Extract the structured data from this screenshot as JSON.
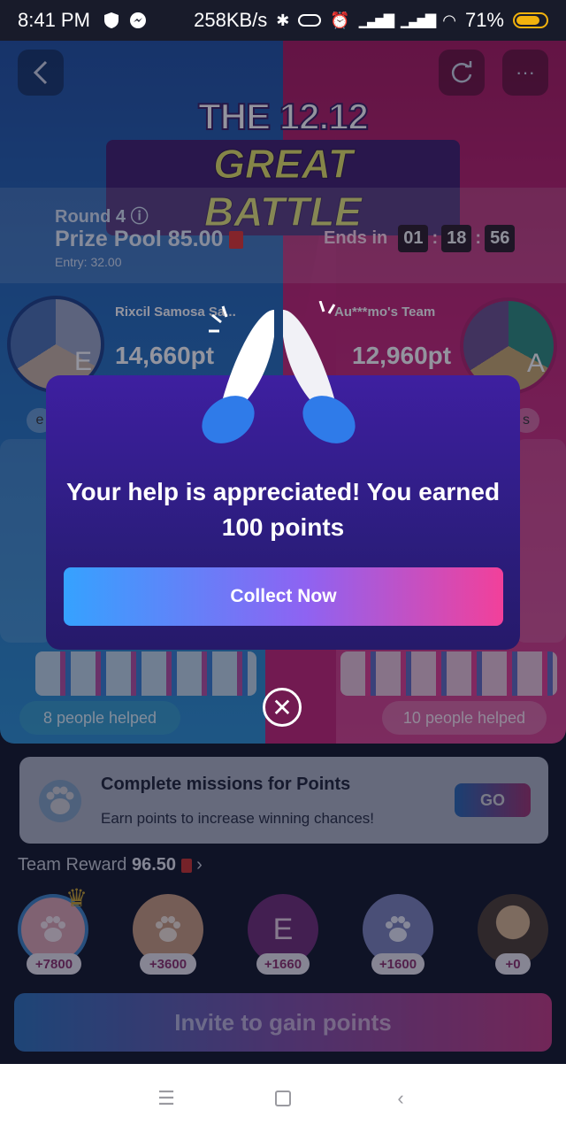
{
  "status_bar": {
    "time": "8:41 PM",
    "network_speed": "258KB/s",
    "battery": "71%"
  },
  "battle": {
    "title_line1": "THE 12.12",
    "title_line2": "GREAT BATTLE",
    "round": "Round 4",
    "prize_pool": "Prize Pool 85.00",
    "entry": "Entry: 32.00",
    "ends_label": "Ends in",
    "timer": [
      "01",
      "18",
      "56"
    ],
    "team_left": {
      "name": "Rixcil Samosa Sa...",
      "points": "14,660pt",
      "avatar_letter": "E",
      "helped": "8 people helped"
    },
    "team_right": {
      "name": "Au***mo's Team",
      "points": "12,960pt",
      "avatar_letter": "A",
      "helped": "10 people helped"
    },
    "left_side_letter": "e",
    "right_side_letter": "s"
  },
  "modal": {
    "message": "Your help is appreciated! You earned 100 points",
    "collect_label": "Collect Now"
  },
  "mission": {
    "title": "Complete missions for Points",
    "subtitle": "Earn points to increase winning chances!",
    "go_label": "GO"
  },
  "team_reward": {
    "label": "Team Reward",
    "value": "96.50",
    "members": [
      {
        "badge": "+7800",
        "letter": "",
        "crown": true
      },
      {
        "badge": "+3600",
        "letter": ""
      },
      {
        "badge": "+1660",
        "letter": "E"
      },
      {
        "badge": "+1600",
        "letter": ""
      },
      {
        "badge": "+0",
        "letter": ""
      }
    ]
  },
  "invite_label": "Invite to gain points",
  "colors": {
    "blue_team": "#226ab9",
    "pink_team": "#c32273",
    "modal_bg": "#2c1d7e"
  }
}
